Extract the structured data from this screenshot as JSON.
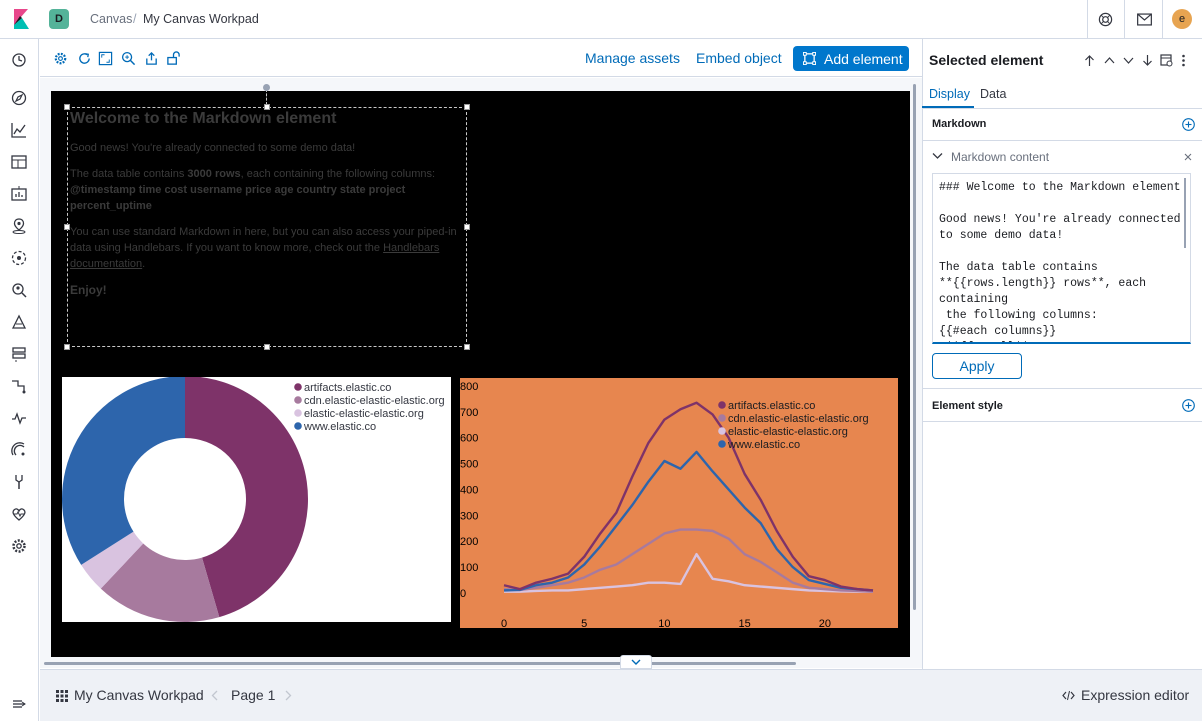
{
  "header": {
    "space_initial": "D",
    "breadcrumbs": [
      "Canvas",
      "My Canvas Workpad"
    ],
    "separator": "/",
    "user_initial": "e"
  },
  "toolbar": {
    "manage_assets": "Manage assets",
    "embed_object": "Embed object",
    "add_element": "Add element"
  },
  "markdown_element": {
    "title": "Welcome to the Markdown element",
    "p1": "Good news! You're already connected to some demo data!",
    "p2_pre": "The data table contains ",
    "p2_bold1": "3000 rows",
    "p2_mid": ", each containing the following columns: ",
    "p2_bold2": "@timestamp time cost username price age country state project percent_uptime",
    "p3_pre": "You can use standard Markdown in here, but you can also access your piped-in data using Handlebars. If you want to know more, check out the ",
    "p3_link": "Handlebars documentation",
    "p3_post": ".",
    "p4": "Enjoy!"
  },
  "chart_data": [
    {
      "type": "pie",
      "variant": "donut",
      "legend": [
        "artifacts.elastic.co",
        "cdn.elastic-elastic-elastic.org",
        "elastic-elastic-elastic.org",
        "www.elastic.co"
      ],
      "values": [
        45.5,
        16.5,
        4,
        34
      ],
      "colors": [
        "#7e3369",
        "#a77a9e",
        "#d9c3e0",
        "#2d65ac"
      ],
      "legend_position": "top-right"
    },
    {
      "type": "line",
      "legend": [
        "artifacts.elastic.co",
        "cdn.elastic-elastic-elastic.org",
        "elastic-elastic-elastic.org",
        "www.elastic.co"
      ],
      "series_colors": [
        "#7e3369",
        "#a77a9e",
        "#d9c3e0",
        "#2d65ac"
      ],
      "x": [
        0,
        1,
        2,
        3,
        4,
        5,
        6,
        7,
        8,
        9,
        10,
        11,
        12,
        13,
        14,
        15,
        16,
        17,
        18,
        19,
        20,
        21,
        22,
        23
      ],
      "series": [
        {
          "name": "artifacts.elastic.co",
          "values": [
            30,
            15,
            40,
            55,
            75,
            140,
            230,
            310,
            450,
            580,
            670,
            710,
            735,
            690,
            600,
            460,
            360,
            240,
            140,
            65,
            50,
            25,
            15,
            10
          ]
        },
        {
          "name": "cdn.elastic-elastic-elastic.org",
          "values": [
            15,
            12,
            20,
            30,
            40,
            60,
            90,
            110,
            150,
            190,
            230,
            245,
            245,
            240,
            210,
            150,
            120,
            80,
            40,
            20,
            15,
            10,
            8,
            5
          ]
        },
        {
          "name": "elastic-elastic-elastic.org",
          "values": [
            5,
            5,
            8,
            10,
            10,
            15,
            20,
            25,
            30,
            40,
            40,
            35,
            150,
            55,
            45,
            30,
            25,
            20,
            15,
            10,
            8,
            6,
            5,
            5
          ]
        },
        {
          "name": "www.elastic.co",
          "values": [
            10,
            12,
            30,
            40,
            60,
            110,
            180,
            260,
            340,
            430,
            510,
            480,
            545,
            470,
            400,
            330,
            270,
            170,
            100,
            50,
            35,
            20,
            15,
            10
          ]
        }
      ],
      "yticks": [
        0,
        100,
        200,
        300,
        400,
        500,
        600,
        700,
        800
      ],
      "xticks": [
        0,
        5,
        10,
        15,
        20
      ],
      "xlim": [
        0,
        23
      ],
      "ylim": [
        0,
        850
      ],
      "legend_position": "top-right"
    }
  ],
  "footer": {
    "workpad_name": "My Canvas Workpad",
    "page_label": "Page 1",
    "expression_editor": "Expression editor"
  },
  "panel": {
    "title": "Selected element",
    "tabs": [
      "Display",
      "Data"
    ],
    "section_markdown": "Markdown",
    "markdown_content_label": "Markdown content",
    "editor_text": "### Welcome to the Markdown element\n\nGood news! You're already connected\nto some demo data!\n\nThe data table contains\n**{{rows.length}} rows**, each\ncontaining\n the following columns:\n{{#each columns}}\n **{{name}}**",
    "apply": "Apply",
    "section_style": "Element style"
  }
}
